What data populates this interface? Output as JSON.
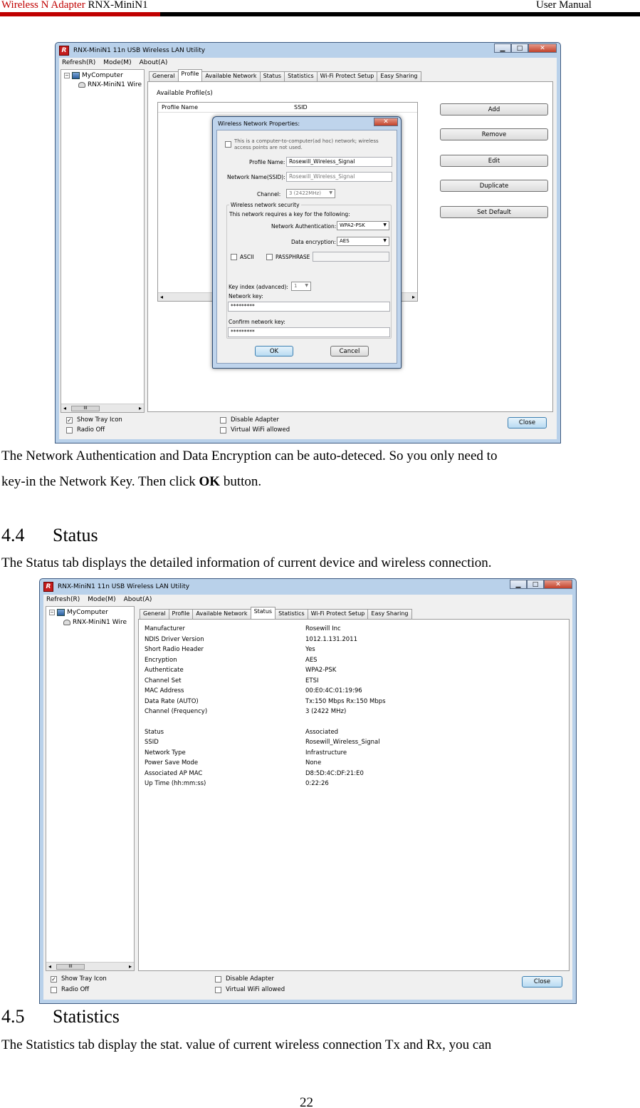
{
  "header": {
    "product": "Wireless N Adapter",
    "model": " RNX-MiniN1",
    "manual": "User Manual"
  },
  "paragraphs": {
    "p1_line1": "The Network Authentication and Data Encryption can be auto-deteced. So you only need to",
    "p1_line2_pre": "key-in the Network Key. Then click ",
    "p1_line2_bold": "OK",
    "p1_line2_post": " button.",
    "p2": "The Status tab displays the detailed information of current device and wireless connection.",
    "p3": "The Statistics tab display the stat. value of current wireless connection Tx and Rx, you can"
  },
  "sections": {
    "status_num": "4.4",
    "status_title": "Status",
    "stats_num": "4.5",
    "stats_title": "Statistics"
  },
  "page_number": "22",
  "window": {
    "title": "RNX-MiniN1 11n USB Wireless LAN Utility",
    "logo": "R",
    "minimize": "▁",
    "maximize": "□",
    "close": "✕",
    "menu": [
      "Refresh(R)",
      "Mode(M)",
      "About(A)"
    ],
    "menu2": [
      "Refresh(R)",
      "Mode(M)",
      "About(A)"
    ],
    "tree_root": "MyComputer",
    "tree_child": "RNX-MiniN1 Wire",
    "tree_scroll_left": "◂",
    "tree_scroll_right": "▸",
    "tree_scroll_thumb": "III",
    "tabs": [
      "General",
      "Profile",
      "Available Network",
      "Status",
      "Statistics",
      "Wi-Fi Protect Setup",
      "Easy Sharing"
    ],
    "show_tray_icon": "Show Tray Icon",
    "radio_off": "Radio Off",
    "disable_adapter": "Disable Adapter",
    "virtual_wifi": "Virtual WiFi allowed",
    "close_button": "Close",
    "check_mark": "✓"
  },
  "profile_tab": {
    "available_profiles": "Available Profile(s)",
    "col_profile_name": "Profile Name",
    "col_ssid": "SSID",
    "buttons": [
      "Add",
      "Remove",
      "Edit",
      "Duplicate",
      "Set Default"
    ],
    "scroll_left": "◂",
    "scroll_right": "▸"
  },
  "dialog": {
    "title": "Wireless Network Properties:",
    "close": "✕",
    "adhoc_text_1": "This is a computer-to-computer(ad hoc) network; wireless",
    "adhoc_text_2": "access points are not used.",
    "profile_name_label": "Profile Name:",
    "profile_name_value": "Rosewill_Wireless_Signal",
    "network_name_label": "Network Name(SSID):",
    "network_name_value": "Rosewill_Wireless_Signal",
    "channel_label": "Channel:",
    "channel_value": "3  (2422MHz)",
    "security_group": "Wireless network security",
    "requires_key": "This network requires a key for the following:",
    "auth_label": "Network Authentication:",
    "auth_value": "WPA2-PSK",
    "enc_label": "Data encryption:",
    "enc_value": "AES",
    "ascii": "ASCII",
    "passphrase": "PASSPHRASE",
    "key_index_label": "Key index (advanced):",
    "key_index_value": "1",
    "network_key_label": "Network key:",
    "network_key_value": "*********",
    "confirm_key_label": "Confirm network key:",
    "confirm_key_value": "*********",
    "ok": "OK",
    "cancel": "Cancel",
    "dropdown_arrow": "▼"
  },
  "status_tab": {
    "rows": [
      [
        "Manufacturer",
        "Rosewill Inc"
      ],
      [
        "NDIS Driver Version",
        "1012.1.131.2011"
      ],
      [
        "Short Radio Header",
        "Yes"
      ],
      [
        "Encryption",
        "AES"
      ],
      [
        "Authenticate",
        "WPA2-PSK"
      ],
      [
        "Channel Set",
        "ETSI"
      ],
      [
        "MAC Address",
        "00:E0:4C:01:19:96"
      ],
      [
        "Data Rate (AUTO)",
        "Tx:150 Mbps Rx:150 Mbps"
      ],
      [
        "Channel (Frequency)",
        "3 (2422 MHz)"
      ],
      [
        "Status",
        "Associated"
      ],
      [
        "SSID",
        "Rosewill_Wireless_Signal"
      ],
      [
        "Network Type",
        "Infrastructure"
      ],
      [
        "Power Save Mode",
        "None"
      ],
      [
        "Associated AP MAC",
        "D8:5D:4C:DF:21:E0"
      ],
      [
        "Up Time (hh:mm:ss)",
        "0:22:26"
      ]
    ]
  }
}
